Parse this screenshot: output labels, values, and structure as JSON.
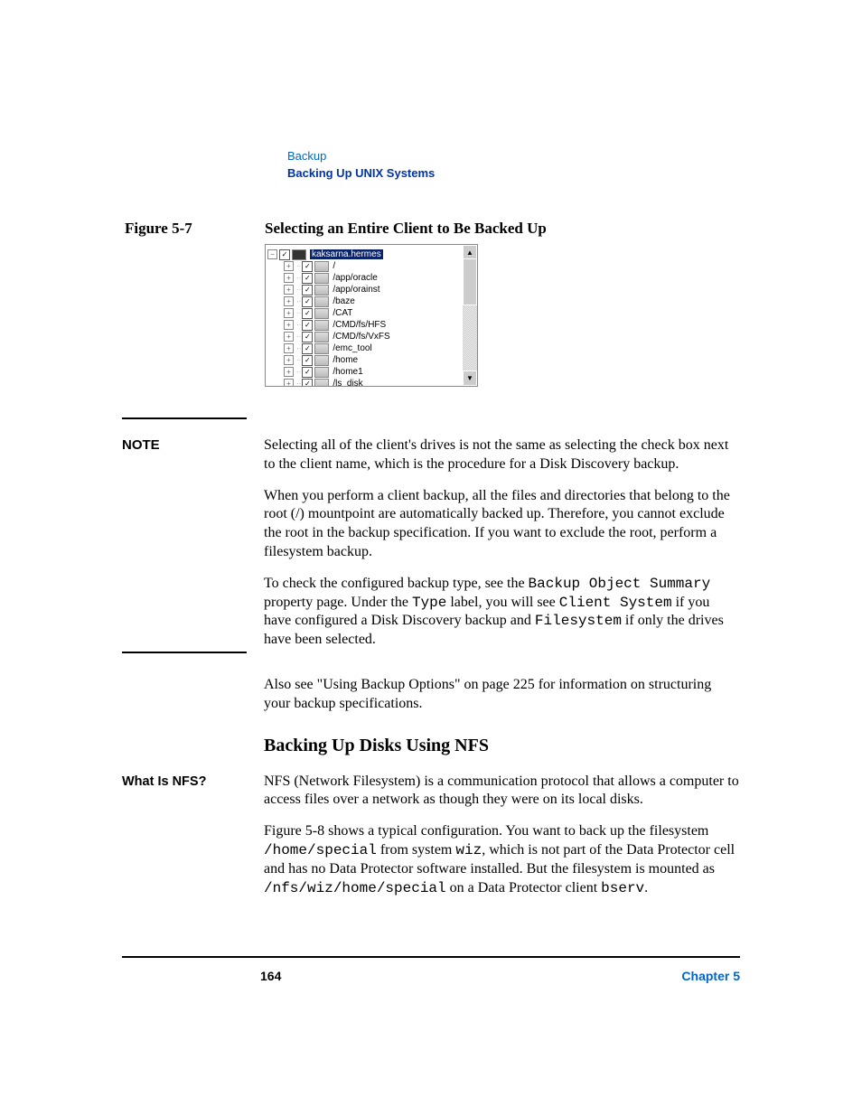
{
  "header": {
    "line1": "Backup",
    "line2": "Backing Up UNIX Systems"
  },
  "figure": {
    "label": "Figure 5-7",
    "title": "Selecting an Entire Client to Be Backed Up"
  },
  "tree": {
    "root": "kaksarna.hermes",
    "items": [
      "/",
      "/app/oracle",
      "/app/orainst",
      "/baze",
      "/CAT",
      "/CMD/fs/HFS",
      "/CMD/fs/VxFS",
      "/emc_tool",
      "/home",
      "/home1",
      "/ls_disk"
    ]
  },
  "noteLabel": "NOTE",
  "note": {
    "p1": "Selecting all of the client's drives is not the same as selecting the check box next to the client name, which is the procedure for a Disk Discovery backup.",
    "p2": "When you perform a client backup, all the files and directories that belong to the root (/) mountpoint are automatically backed up. Therefore, you cannot exclude the root in the backup specification. If you want to exclude the root, perform a filesystem backup.",
    "p3a": "To check the configured backup type, see the ",
    "p3b": "Backup Object Summary",
    "p3c": " property page. Under the ",
    "p3d": "Type",
    "p3e": " label, you will see ",
    "p3f": "Client System",
    "p3g": " if you have configured a Disk Discovery backup and ",
    "p3h": "Filesystem",
    "p3i": " if only the drives have been selected."
  },
  "after": {
    "p1": "Also see \"Using Backup Options\" on page 225 for information on structuring your backup specifications.",
    "h2": "Backing Up Disks Using NFS"
  },
  "sidehead_nfs": "What Is NFS?",
  "nfs": {
    "p1": "NFS (Network Filesystem) is a communication protocol that allows a computer to access files over a network as though they were on its local disks.",
    "p2a": "Figure 5-8 shows a typical configuration. You want to back up the filesystem ",
    "p2b": "/home/special",
    "p2c": " from system ",
    "p2d": "wiz",
    "p2e": ", which is not part of the Data Protector cell and has no Data Protector software installed. But the filesystem is mounted as  ",
    "p2f": "/nfs/wiz/home/special",
    "p2g": " on a Data Protector client ",
    "p2h": "bserv",
    "p2i": "."
  },
  "footer": {
    "page": "164",
    "chapter": "Chapter 5"
  }
}
